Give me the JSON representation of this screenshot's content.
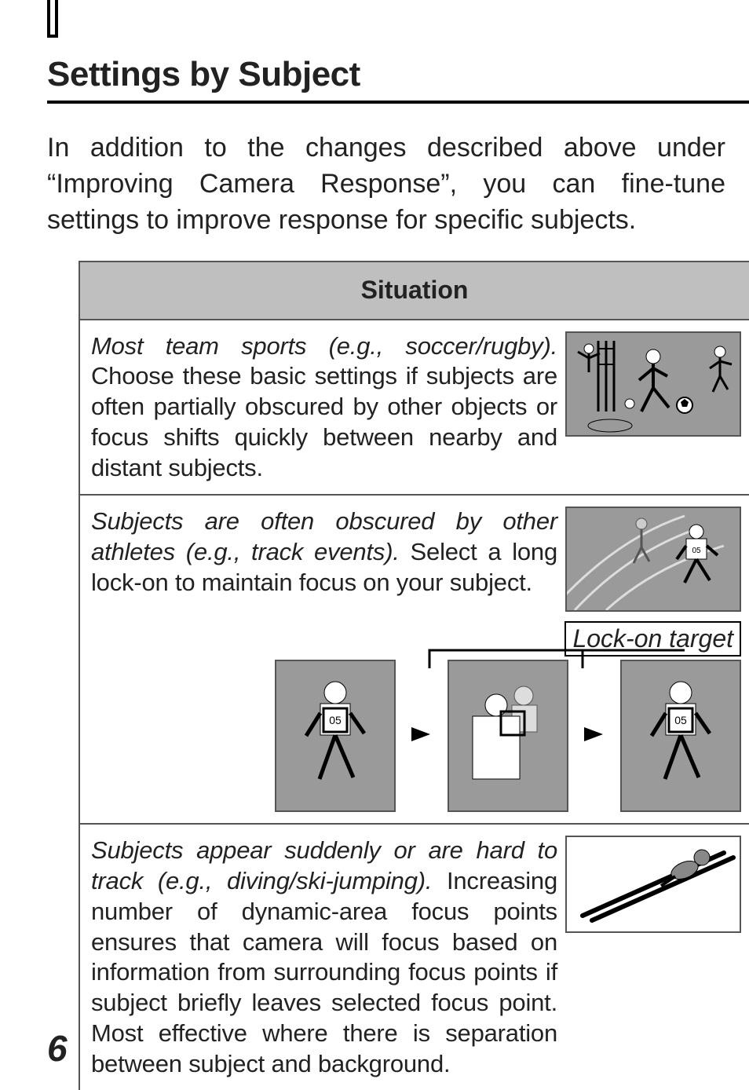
{
  "page_number": "6",
  "section_title": "Settings by Subject",
  "intro": "In addition to the changes described above under “Improving Camera Response”, you can fine-tune settings to improve response for specific subjects.",
  "table_header": "Situation",
  "lock_on_label": "Lock-on target",
  "rows": [
    {
      "lead": "Most team sports (e.g., soccer/rugby).",
      "body": " Choose these basic settings if subjects are often partially obscured by other objects or focus shifts quickly between nearby and distant subjects."
    },
    {
      "lead": "Subjects are often obscured by other athletes (e.g., track events).",
      "body": "  Select a long lock-on to maintain focus on your subject."
    },
    {
      "lead": "Subjects appear suddenly or are hard to track (e.g., diving/ski-jumping).",
      "body": " Increasing number of dynamic-area focus points ensures that camera will focus based on information from surrounding focus points if subject briefly leaves selected focus point. Most effective where there is separation between subject and background."
    }
  ]
}
